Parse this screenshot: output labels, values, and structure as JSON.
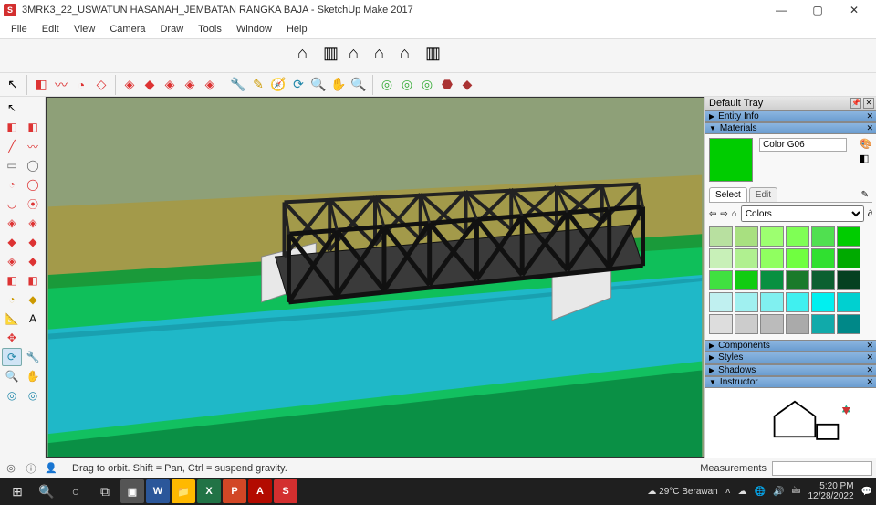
{
  "window": {
    "title": "3MRK3_22_USWATUN HASANAH_JEMBATAN RANGKA BAJA - SketchUp Make 2017",
    "min": "—",
    "max": "▢",
    "close": "✕"
  },
  "menubar": [
    "File",
    "Edit",
    "View",
    "Camera",
    "Draw",
    "Tools",
    "Window",
    "Help"
  ],
  "top_toolbar": {
    "large": [
      "⌂",
      "▥",
      "⌂",
      "⌂",
      "⌂",
      "▥"
    ]
  },
  "row2": {
    "first": "↖",
    "groups": [
      [
        "◧",
        "〰",
        "◔",
        "◇"
      ],
      [
        "◈",
        "◆",
        "◈",
        "◈",
        "◈"
      ],
      [
        "🔧",
        "✎",
        "🧭",
        "⟳",
        "🔍",
        "✋",
        "🔍"
      ],
      [
        "◎",
        "◎",
        "◎",
        "⬣",
        "◆"
      ]
    ]
  },
  "left_tools": [
    [
      "↖",
      ""
    ],
    [
      "◧",
      "◧"
    ],
    [
      "╱",
      "〰"
    ],
    [
      "▭",
      "◯"
    ],
    [
      "◔",
      "◯"
    ],
    [
      "◡",
      "⦿"
    ],
    [
      "◈",
      "◈"
    ],
    [
      "◆",
      "◆"
    ],
    [
      "◈",
      "◆"
    ],
    [
      "◧",
      "◧"
    ],
    [
      "◔",
      "◆"
    ],
    [
      "📐",
      "A"
    ],
    [
      "✥",
      ""
    ],
    [
      "⟳",
      "🔧"
    ],
    [
      "🔍",
      "✋"
    ],
    [
      "◎",
      "◎"
    ]
  ],
  "tray": {
    "title": "Default Tray",
    "sections": {
      "entity": "Entity Info",
      "materials": "Materials",
      "components": "Components",
      "styles": "Styles",
      "shadows": "Shadows",
      "instructor": "Instructor"
    }
  },
  "materials": {
    "name": "Color G06",
    "tabs": {
      "select": "Select",
      "edit": "Edit"
    },
    "picker_label": "Colors",
    "swatches": [
      "#b8e0a0",
      "#a8e080",
      "#9dff70",
      "#7fff55",
      "#50e050",
      "#0c0",
      "#c8f0b8",
      "#b0f090",
      "#90ff60",
      "#70ff40",
      "#30e030",
      "#0a0",
      "#40e040",
      "#1c1",
      "#089040",
      "#1a7a2a",
      "#0c6030",
      "#064020",
      "#c0f0f0",
      "#a0f0f0",
      "#80f0f0",
      "#40f0f0",
      "#00f0f0",
      "#00d0d0",
      "#ddd",
      "#ccc",
      "#bbb",
      "#aaa",
      "#1aa",
      "#088"
    ]
  },
  "status": {
    "hint": "Drag to orbit. Shift = Pan, Ctrl = suspend gravity.",
    "meas_label": "Measurements"
  },
  "taskbar": {
    "weather": "29°C Berawan",
    "time": "5:20 PM",
    "date": "12/28/2022"
  }
}
